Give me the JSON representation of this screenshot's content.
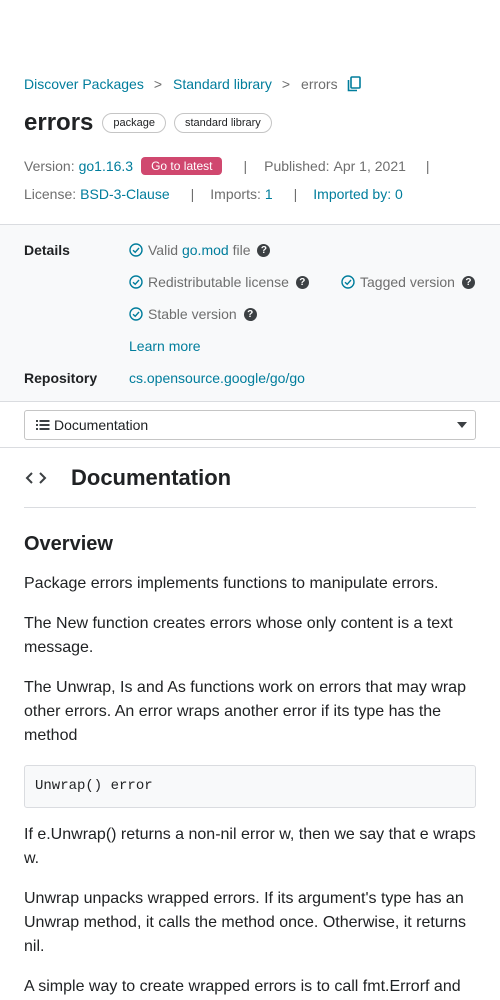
{
  "breadcrumb": {
    "items": [
      "Discover Packages",
      "Standard library"
    ],
    "separator": ">",
    "current": "errors"
  },
  "header": {
    "title": "errors",
    "chips": [
      "package",
      "standard library"
    ]
  },
  "meta": {
    "version_label": "Version:",
    "version_value": "go1.16.3",
    "latest_badge": "Go to latest",
    "published_label": "Published:",
    "published_value": "Apr 1, 2021",
    "license_label": "License:",
    "license_value": "BSD-3-Clause",
    "imports_label": "Imports:",
    "imports_value": "1",
    "imported_by": "Imported by: 0",
    "separator": "|"
  },
  "details": {
    "heading": "Details",
    "valid_prefix": "Valid",
    "valid_link": "go.mod",
    "valid_suffix": "file",
    "redistributable": "Redistributable license",
    "tagged": "Tagged version",
    "stable": "Stable version",
    "learn_more": "Learn more",
    "help_glyph": "?"
  },
  "repository": {
    "heading": "Repository",
    "url": "cs.opensource.google/go/go"
  },
  "nav_select": {
    "selected": "Documentation"
  },
  "documentation": {
    "title": "Documentation",
    "overview_heading": "Overview",
    "paragraphs": [
      "Package errors implements functions to manipulate errors.",
      "The New function creates errors whose only content is a text message.",
      "The Unwrap, Is and As functions work on errors that may wrap other errors. An error wraps another error if its type has the method",
      "If e.Unwrap() returns a non-nil error w, then we say that e wraps w.",
      "Unwrap unpacks wrapped errors. If its argument's type has an Unwrap method, it calls the method once. Otherwise, it returns nil.",
      "A simple way to create wrapped errors is to call fmt.Errorf and"
    ],
    "code": "Unwrap() error"
  },
  "colors": {
    "link": "#007d9c",
    "badge": "#d0486f",
    "panel_bg": "#f8f9fa"
  }
}
